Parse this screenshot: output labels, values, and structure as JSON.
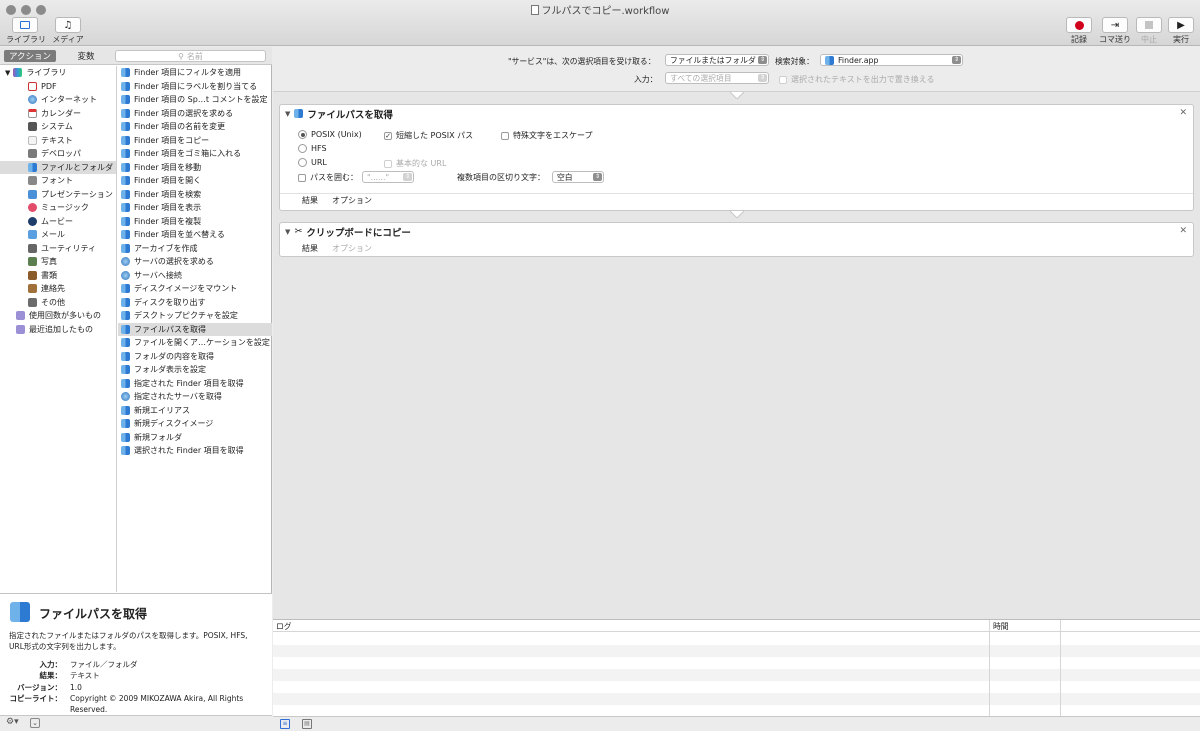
{
  "window": {
    "title": "フルパスでコピー.workflow",
    "toolbar_left": [
      {
        "label": "ライブラリ",
        "icon": "library-icon"
      },
      {
        "label": "メディア",
        "icon": "media-icon"
      }
    ],
    "toolbar_right": [
      {
        "label": "記録",
        "icon": "record-icon",
        "enabled": true
      },
      {
        "label": "コマ送り",
        "icon": "step-icon",
        "enabled": true
      },
      {
        "label": "中止",
        "icon": "stop-icon",
        "enabled": false
      },
      {
        "label": "実行",
        "icon": "run-icon",
        "enabled": true
      }
    ]
  },
  "library": {
    "tabs": {
      "actions": "アクション",
      "variables": "変数"
    },
    "search_placeholder": "名前",
    "categories": [
      {
        "label": "ライブラリ",
        "icon": "library-icon"
      },
      {
        "label": "PDF",
        "icon": "pdf-icon"
      },
      {
        "label": "インターネット",
        "icon": "globe-icon"
      },
      {
        "label": "カレンダー",
        "icon": "calendar-icon"
      },
      {
        "label": "システム",
        "icon": "system-icon"
      },
      {
        "label": "テキスト",
        "icon": "text-icon"
      },
      {
        "label": "デベロッパ",
        "icon": "developer-icon"
      },
      {
        "label": "ファイルとフォルダ",
        "icon": "finder-icon",
        "selected": true
      },
      {
        "label": "フォント",
        "icon": "font-icon"
      },
      {
        "label": "プレゼンテーション",
        "icon": "presentation-icon"
      },
      {
        "label": "ミュージック",
        "icon": "music-icon"
      },
      {
        "label": "ムービー",
        "icon": "movie-icon"
      },
      {
        "label": "メール",
        "icon": "mail-icon"
      },
      {
        "label": "ユーティリティ",
        "icon": "utility-icon"
      },
      {
        "label": "写真",
        "icon": "photo-icon"
      },
      {
        "label": "書類",
        "icon": "document-icon"
      },
      {
        "label": "連絡先",
        "icon": "contacts-icon"
      },
      {
        "label": "その他",
        "icon": "other-icon"
      },
      {
        "label": "使用回数が多いもの",
        "icon": "smart-folder-icon"
      },
      {
        "label": "最近追加したもの",
        "icon": "smart-folder-icon"
      }
    ],
    "actions": [
      {
        "label": "Finder 項目にフィルタを適用",
        "icon": "finder-icon"
      },
      {
        "label": "Finder 項目にラベルを割り当てる",
        "icon": "finder-icon"
      },
      {
        "label": "Finder 項目の Sp…t コメントを設定",
        "icon": "finder-icon"
      },
      {
        "label": "Finder 項目の選択を求める",
        "icon": "finder-icon"
      },
      {
        "label": "Finder 項目の名前を変更",
        "icon": "finder-icon"
      },
      {
        "label": "Finder 項目をコピー",
        "icon": "finder-icon"
      },
      {
        "label": "Finder 項目をゴミ箱に入れる",
        "icon": "finder-icon"
      },
      {
        "label": "Finder 項目を移動",
        "icon": "finder-icon"
      },
      {
        "label": "Finder 項目を開く",
        "icon": "finder-icon"
      },
      {
        "label": "Finder 項目を検索",
        "icon": "finder-icon"
      },
      {
        "label": "Finder 項目を表示",
        "icon": "finder-icon"
      },
      {
        "label": "Finder 項目を複製",
        "icon": "finder-icon"
      },
      {
        "label": "Finder 項目を並べ替える",
        "icon": "finder-icon"
      },
      {
        "label": "アーカイブを作成",
        "icon": "finder-icon"
      },
      {
        "label": "サーバの選択を求める",
        "icon": "globe-icon"
      },
      {
        "label": "サーバへ接続",
        "icon": "globe-icon"
      },
      {
        "label": "ディスクイメージをマウント",
        "icon": "finder-icon"
      },
      {
        "label": "ディスクを取り出す",
        "icon": "finder-icon"
      },
      {
        "label": "デスクトップピクチャを設定",
        "icon": "finder-icon"
      },
      {
        "label": "ファイルパスを取得",
        "icon": "finder-icon",
        "selected": true
      },
      {
        "label": "ファイルを開くア…ケーションを設定",
        "icon": "finder-icon"
      },
      {
        "label": "フォルダの内容を取得",
        "icon": "finder-icon"
      },
      {
        "label": "フォルダ表示を設定",
        "icon": "finder-icon"
      },
      {
        "label": "指定された Finder 項目を取得",
        "icon": "finder-icon"
      },
      {
        "label": "指定されたサーバを取得",
        "icon": "globe-icon"
      },
      {
        "label": "新規エイリアス",
        "icon": "finder-icon"
      },
      {
        "label": "新規ディスクイメージ",
        "icon": "finder-icon"
      },
      {
        "label": "新規フォルダ",
        "icon": "finder-icon"
      },
      {
        "label": "選択された Finder 項目を取得",
        "icon": "finder-icon"
      }
    ]
  },
  "description": {
    "title": "ファイルパスを取得",
    "text": "指定されたファイルまたはフォルダのパスを取得します。POSIX, HFS, URL形式の文字列を出力します。",
    "meta": [
      {
        "key": "入力：",
        "value": "ファイル／フォルダ"
      },
      {
        "key": "結果：",
        "value": "テキスト"
      },
      {
        "key": "バージョン：",
        "value": "1.0"
      },
      {
        "key": "コピーライト：",
        "value": "Copyright © 2009 MIKOZAWA Akira, All Rights Reserved."
      }
    ]
  },
  "service": {
    "receives_label": "\"サービス\"は、次の選択項目を受け取る：",
    "receives_value": "ファイルまたはフォルダ",
    "target_label": "検索対象：",
    "target_value": "Finder.app",
    "input_label": "入力：",
    "input_value": "すべての選択項目",
    "replace_label": "選択されたテキストを出力で置き換える"
  },
  "workflow": {
    "action1": {
      "title": "ファイルパスを取得",
      "radio_posix": "POSIX (Unix)",
      "radio_hfs": "HFS",
      "radio_url": "URL",
      "chk_short": "短縮した POSIX パス",
      "chk_escape": "特殊文字をエスケープ",
      "chk_baseurl": "基本的な URL",
      "chk_quote": "パスを囲む：",
      "quote_value": "\"......\"",
      "separator_label": "複数項目の区切り文字：",
      "separator_value": "空白",
      "tab_results": "結果",
      "tab_options": "オプション"
    },
    "action2": {
      "title": "クリップボードにコピー",
      "tab_results": "結果",
      "tab_options": "オプション"
    }
  },
  "log": {
    "col_log": "ログ",
    "col_time": "時間"
  },
  "colors": {
    "record": "#d0021b",
    "selection": "#dcdcdc",
    "finder_light": "#6fb2ea",
    "finder_dark": "#2d7ad2"
  }
}
